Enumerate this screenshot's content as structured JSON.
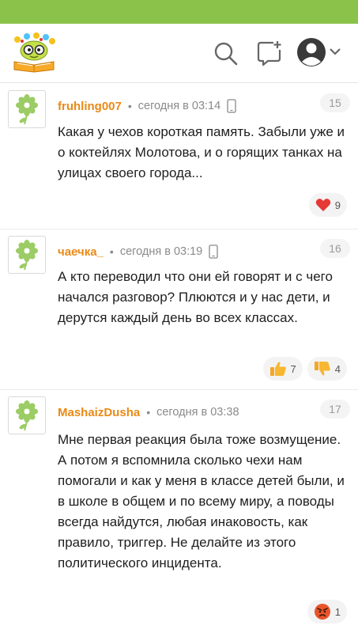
{
  "colors": {
    "status_bar": "#8bc34a",
    "author": "#e98a16",
    "avatar_flower": "#9ccc65"
  },
  "header": {
    "logo": "bookworm-logo",
    "icons": [
      "search-icon",
      "add-post-icon",
      "user-avatar-icon",
      "chevron-down-icon"
    ]
  },
  "comments": [
    {
      "author": "fruhling007",
      "time": "сегодня в 03:14",
      "number": "15",
      "text": "Какая у чехов короткая память. Забыли уже и о коктейлях Молотова, и о горящих танках на улицах своего города...",
      "reactions": [
        {
          "icon": "heart-icon",
          "count": "9"
        }
      ]
    },
    {
      "author": "чаечка_",
      "time": "сегодня в 03:19",
      "number": "16",
      "text": "А кто переводил что они ей говорят и с чего начался разговор? Плюются и у нас дети, и дерутся каждый день во всех классах.",
      "reactions": [
        {
          "icon": "thumbs-up-icon",
          "count": "7"
        },
        {
          "icon": "thumbs-down-icon",
          "count": "4"
        }
      ]
    },
    {
      "author": "MashaizDusha",
      "time": "сегодня в 03:38",
      "number": "17",
      "text": "Мне первая реакция была тоже возмущение. А потом я вспомнила сколько чехи нам помогали и как у меня в классе детей были, и в школе в общем и по всему миру, а поводы всегда найдутся, любая инаковость, как правило, триггер. Не делайте из этого политического инцидента.",
      "reactions": [
        {
          "icon": "angry-face-icon",
          "count": "1"
        }
      ]
    }
  ]
}
